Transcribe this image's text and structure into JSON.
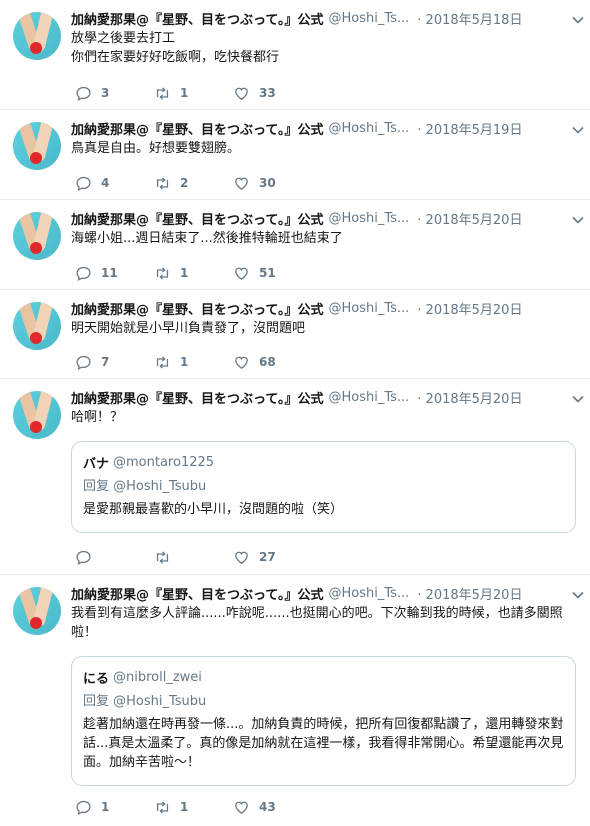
{
  "tweets": [
    {
      "name": "加納愛那果@『星野、目をつぶって。』公式",
      "handle": "@Hoshi_Ts...",
      "date": "· 2018年5月18日",
      "text": "放學之後要去打工\n你們在家要好好吃飯啊，吃快餐都行",
      "replies": "3",
      "retweets": "1",
      "likes": "33"
    },
    {
      "name": "加納愛那果@『星野、目をつぶって。』公式",
      "handle": "@Hoshi_Ts...",
      "date": "· 2018年5月19日",
      "text": "鳥真是自由。好想要雙翅膀。",
      "replies": "4",
      "retweets": "2",
      "likes": "30"
    },
    {
      "name": "加納愛那果@『星野、目をつぶって。』公式",
      "handle": "@Hoshi_Ts...",
      "date": "· 2018年5月20日",
      "text": "海螺小姐...週日結束了...然後推特輪班也結束了",
      "replies": "11",
      "retweets": "1",
      "likes": "51"
    },
    {
      "name": "加納愛那果@『星野、目をつぶって。』公式",
      "handle": "@Hoshi_Ts...",
      "date": "· 2018年5月20日",
      "text": "明天開始就是小早川負責發了，沒問題吧",
      "replies": "7",
      "retweets": "1",
      "likes": "68"
    },
    {
      "name": "加納愛那果@『星野、目をつぶって。』公式",
      "handle": "@Hoshi_Ts...",
      "date": "· 2018年5月20日",
      "text": "哈啊！？",
      "replies": "",
      "retweets": "",
      "likes": "27",
      "quote": {
        "name": "バナ",
        "handle": "@montaro1225",
        "reply_to": "回复 @Hoshi_Tsubu",
        "text": "是愛那親最喜歡的小早川，沒問題的啦（笑）"
      }
    },
    {
      "name": "加納愛那果@『星野、目をつぶって。』公式",
      "handle": "@Hoshi_Ts...",
      "date": "· 2018年5月20日",
      "text": "我看到有這麼多人評論......咋說呢......也挺開心的吧。下次輪到我的時候，也請多關照啦！",
      "replies": "1",
      "retweets": "1",
      "likes": "43",
      "quote": {
        "name": "にる",
        "handle": "@nibroll_zwei",
        "reply_to": "回复 @Hoshi_Tsubu",
        "text": "趁著加納還在時再發一條...。加納負責的時候，把所有回復都點讚了，還用轉發來對話...真是太溫柔了。真的像是加納就在這裡一樣，我看得非常開心。希望還能再次見面。加納辛苦啦～！"
      }
    }
  ],
  "colors": {
    "text": "#14171a",
    "muted": "#657786",
    "border": "#e6ecf0",
    "quote_border": "#ccd6dd"
  },
  "icons": {
    "reply": "reply-icon",
    "retweet": "retweet-icon",
    "like": "heart-icon",
    "menu": "chevron-down-icon"
  }
}
